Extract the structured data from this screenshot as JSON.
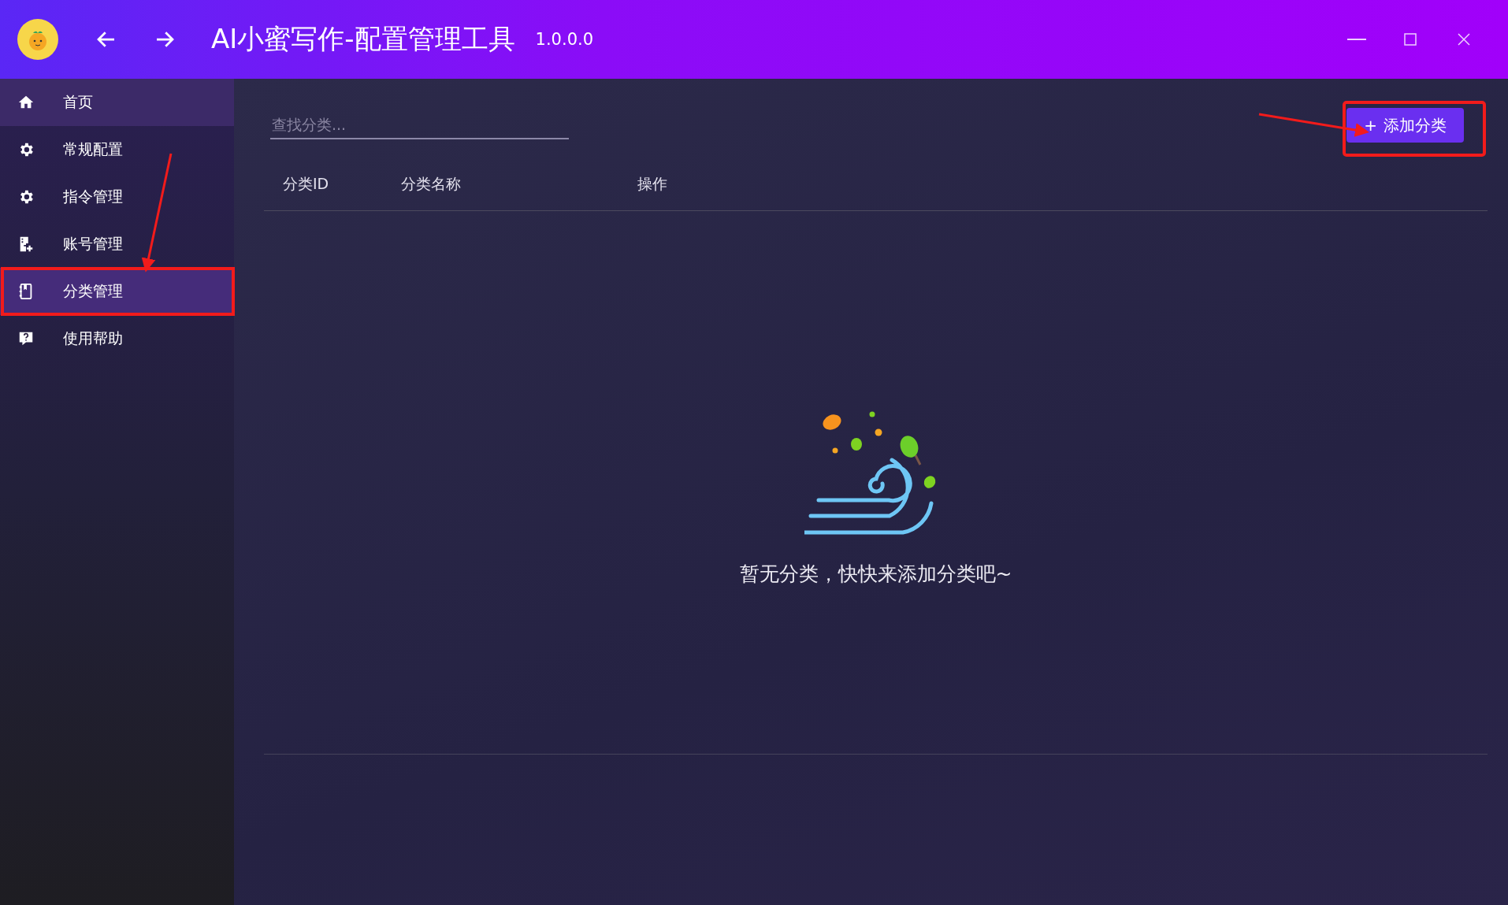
{
  "window": {
    "title": "AI小蜜写作-配置管理工具",
    "version": "1.0.0.0"
  },
  "sidebar": {
    "items": [
      {
        "label": "首页",
        "selected": false,
        "hovered": true
      },
      {
        "label": "常规配置",
        "selected": false,
        "hovered": false
      },
      {
        "label": "指令管理",
        "selected": false,
        "hovered": false
      },
      {
        "label": "账号管理",
        "selected": false,
        "hovered": false
      },
      {
        "label": "分类管理",
        "selected": true,
        "hovered": false
      },
      {
        "label": "使用帮助",
        "selected": false,
        "hovered": false
      }
    ]
  },
  "search": {
    "placeholder": "查找分类..."
  },
  "add_button": {
    "icon": "+",
    "label": "添加分类"
  },
  "table": {
    "columns": [
      "分类ID",
      "分类名称",
      "操作"
    ]
  },
  "empty_state": {
    "message": "暂无分类，快快来添加分类吧~"
  }
}
